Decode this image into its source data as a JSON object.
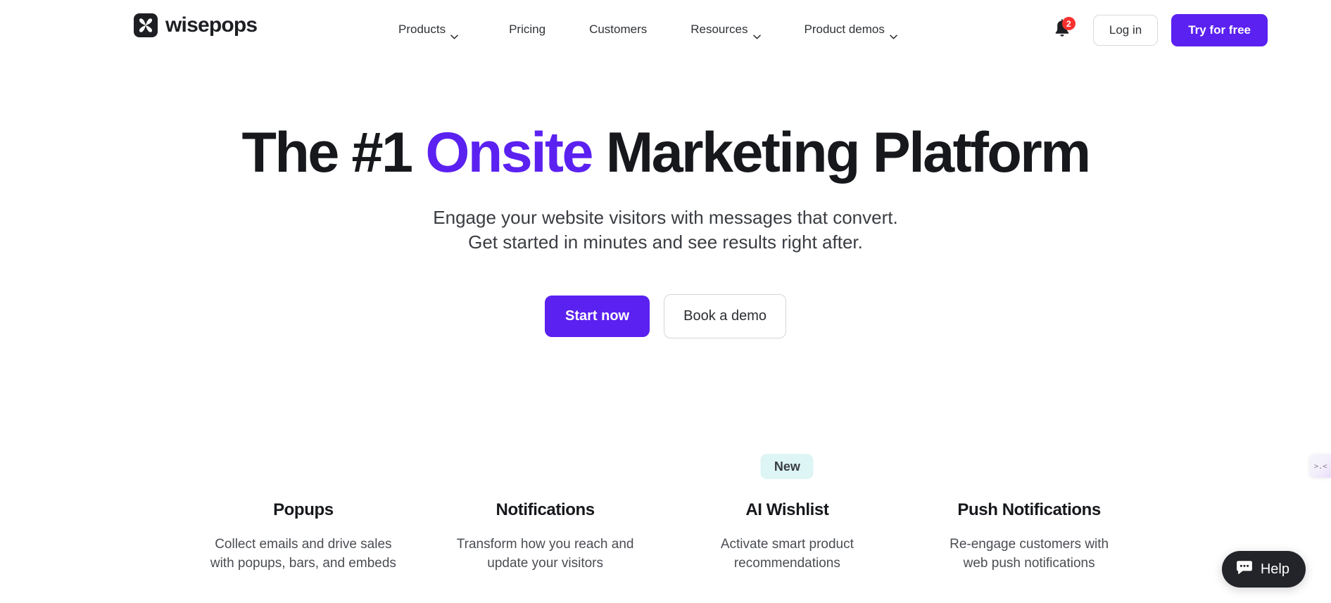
{
  "header": {
    "brand": {
      "name": "wisepops",
      "logo_icon": "wisepops-pinwheel-logo-icon"
    },
    "nav": [
      {
        "label": "Products",
        "has_dropdown": true
      },
      {
        "label": "Pricing",
        "has_dropdown": false
      },
      {
        "label": "Customers",
        "has_dropdown": false
      },
      {
        "label": "Resources",
        "has_dropdown": true
      },
      {
        "label": "Product demos",
        "has_dropdown": true
      }
    ],
    "notifications": {
      "icon": "bell-icon",
      "badge_count": "2",
      "badge_color": "#f8312f"
    },
    "login_label": "Log in",
    "try_label": "Try for free"
  },
  "hero": {
    "title_part1": "The #1 ",
    "title_highlight": "Onsite",
    "title_part2": " Marketing Platform",
    "highlight_color": "#5b21f0",
    "subtitle_line1": "Engage your website visitors with messages that convert.",
    "subtitle_line2": "Get started in minutes and see results right after.",
    "primary_cta": "Start now",
    "secondary_cta": "Book a demo"
  },
  "features": [
    {
      "badge": "",
      "title": "Popups",
      "desc_line1": "Collect emails and drive sales",
      "desc_line2": "with popups, bars, and embeds"
    },
    {
      "badge": "",
      "title": "Notifications",
      "desc_line1": "Transform how you reach and",
      "desc_line2": "update your visitors"
    },
    {
      "badge": "New",
      "title": "AI Wishlist",
      "desc_line1": "Activate smart product",
      "desc_line2": "recommendations"
    },
    {
      "badge": "",
      "title": "Push Notifications",
      "desc_line1": "Re-engage customers with",
      "desc_line2": "web push notifications"
    }
  ],
  "widgets": {
    "help_label": "Help",
    "help_icon": "chat-bubble-icon",
    "side_tab_face": ">.<",
    "side_tab_icon": "kaomoji-face-icon"
  },
  "colors": {
    "brand_purple": "#5b21f0",
    "badge_red": "#f8312f",
    "badge_mint": "#ddf5f4",
    "ink": "#16181c"
  }
}
